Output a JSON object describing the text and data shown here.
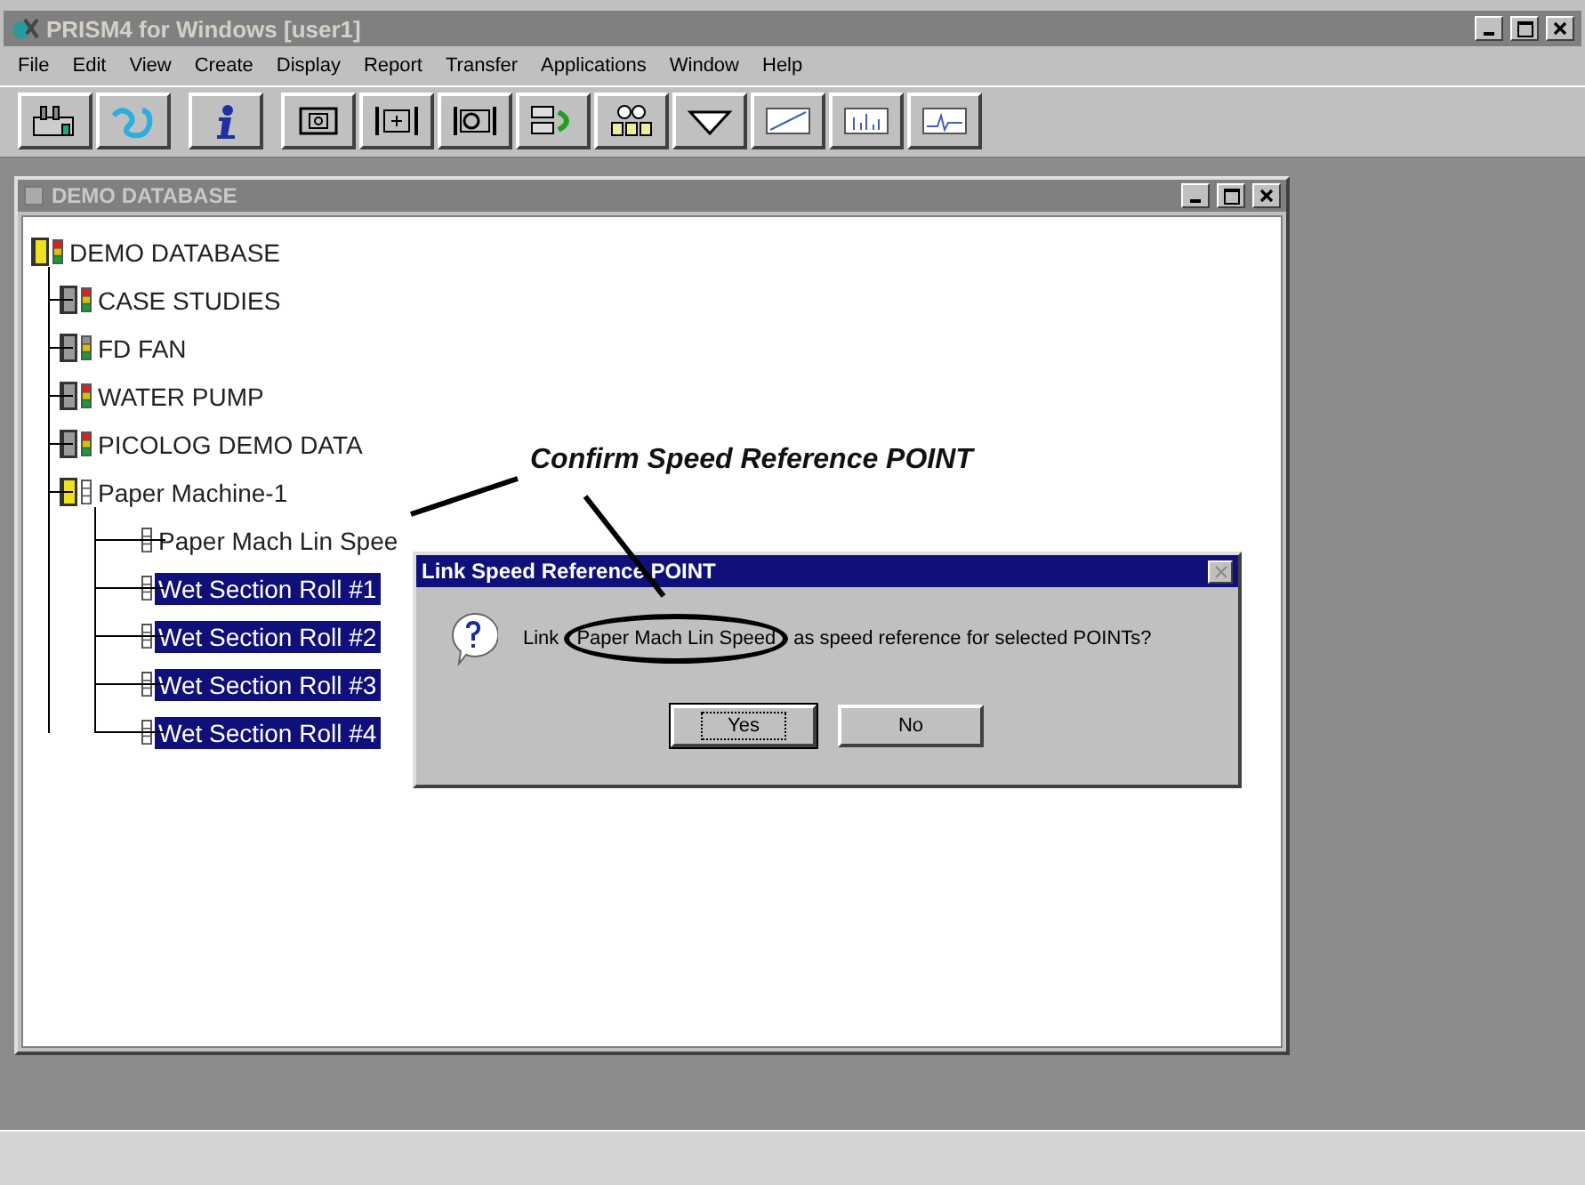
{
  "window": {
    "title": "PRISM4 for Windows [user1]"
  },
  "menu": [
    "File",
    "Edit",
    "View",
    "Create",
    "Display",
    "Report",
    "Transfer",
    "Applications",
    "Window",
    "Help"
  ],
  "toolbar": [
    {
      "kind": "factory"
    },
    {
      "kind": "route"
    },
    {
      "kind": "info"
    },
    {
      "kind": "frame"
    },
    {
      "kind": "plus"
    },
    {
      "kind": "gauge"
    },
    {
      "kind": "link"
    },
    {
      "kind": "group"
    },
    {
      "kind": "filter"
    },
    {
      "kind": "trend"
    },
    {
      "kind": "spectrum"
    },
    {
      "kind": "waveform"
    }
  ],
  "child_window": {
    "title": "DEMO DATABASE",
    "tree": [
      {
        "label": "DEMO DATABASE",
        "kind": "database",
        "lit": true,
        "color": "#e02020",
        "selected": false,
        "children": [
          {
            "label": "CASE STUDIES",
            "kind": "folder",
            "lit": true,
            "color": "#e02020",
            "selected": false
          },
          {
            "label": "FD FAN",
            "kind": "folder",
            "lit": true,
            "color": "#909090",
            "selected": false
          },
          {
            "label": "WATER PUMP",
            "kind": "folder",
            "lit": true,
            "color": "#e02020",
            "selected": false
          },
          {
            "label": "PICOLOG DEMO DATA",
            "kind": "folder",
            "lit": true,
            "color": "#e02020",
            "selected": false
          },
          {
            "label": "Paper Machine-1",
            "kind": "database",
            "lit": false,
            "selected": false,
            "children": [
              {
                "label": "Paper Mach Lin Spee",
                "kind": "point",
                "lit": false,
                "selected": false
              },
              {
                "label": "Wet Section Roll #1",
                "kind": "point",
                "lit": false,
                "selected": true
              },
              {
                "label": "Wet Section Roll #2",
                "kind": "point",
                "lit": false,
                "selected": true
              },
              {
                "label": "Wet Section Roll #3",
                "kind": "point",
                "lit": false,
                "selected": true
              },
              {
                "label": "Wet Section Roll #4",
                "kind": "point",
                "lit": false,
                "selected": true
              }
            ]
          }
        ]
      }
    ]
  },
  "dialog": {
    "title": "Link Speed Reference POINT",
    "message_start": "Link",
    "message_highlight": "Paper Mach Lin Speed",
    "message_end": "as speed reference for selected POINTs?",
    "buttons": [
      {
        "label": "Yes",
        "focused": true
      },
      {
        "label": "No",
        "focused": false
      }
    ]
  },
  "annotation": {
    "text": "Confirm Speed Reference POINT"
  }
}
